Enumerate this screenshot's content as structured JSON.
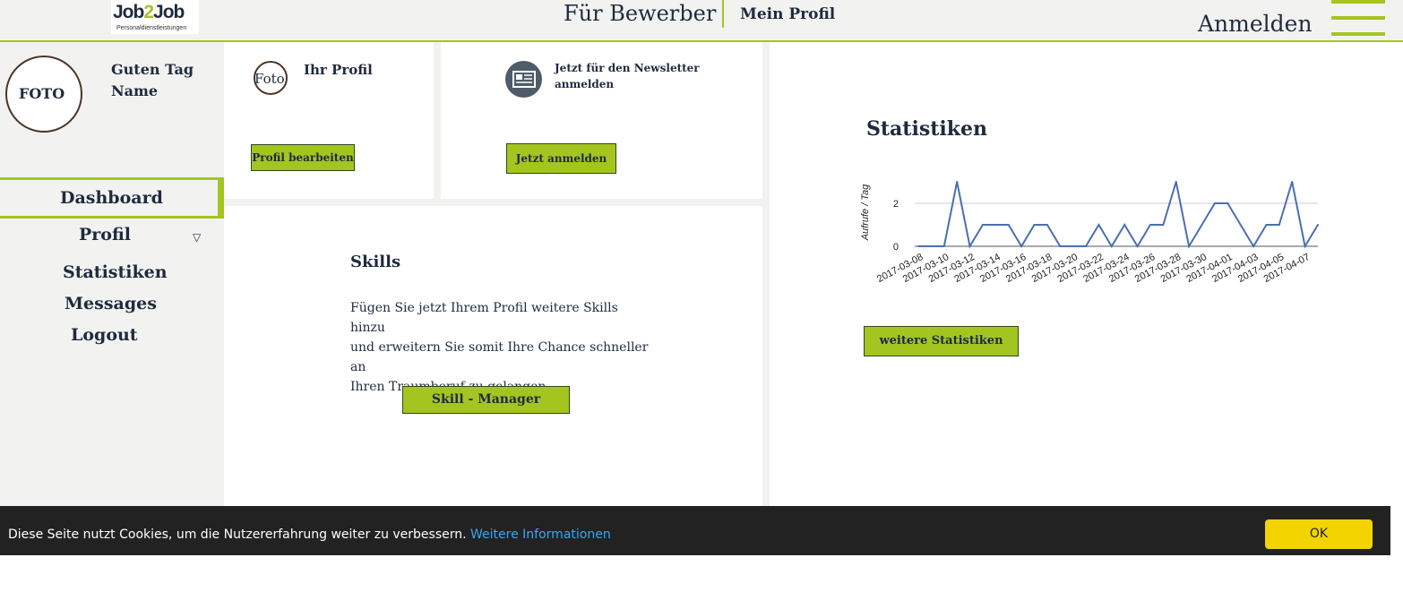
{
  "header": {
    "logo_main_a": "Job",
    "logo_main_b": "2",
    "logo_main_c": "Job",
    "logo_sub": "Personaldienstleistungen",
    "nav_apply": "Für Bewerber",
    "nav_profile": "Mein Profil",
    "login": "Anmelden",
    "menu_icon": "hamburger-icon"
  },
  "sidebar": {
    "avatar_label": "FOTO",
    "greeting_line1": "Guten Tag",
    "greeting_line2": "Name",
    "items": [
      {
        "label": "Dashboard",
        "active": true
      },
      {
        "label": "Profil",
        "has_dropdown": true
      },
      {
        "label": "Statistiken"
      },
      {
        "label": "Messages"
      },
      {
        "label": "Logout"
      }
    ]
  },
  "profile_card": {
    "icon_label": "Foto",
    "title": "Ihr Profil",
    "button": "Profil bearbeiten"
  },
  "newsletter_card": {
    "icon": "newspaper-icon",
    "title_line1": "Jetzt für den Newsletter",
    "title_line2": "anmelden",
    "button": "Jetzt anmelden"
  },
  "skills_card": {
    "title": "Skills",
    "text_line1": "Fügen Sie jetzt Ihrem Profil weitere Skills hinzu",
    "text_line2": "und erweitern Sie somit Ihre Chance schneller an",
    "text_line3": "Ihren Traumberuf zu gelangen.",
    "button": "Skill - Manager"
  },
  "stats_card": {
    "title": "Statistiken",
    "button": "weitere Statistiken"
  },
  "chart_data": {
    "type": "line",
    "ylabel": "Aufrufe / Tag",
    "ylim": [
      0,
      3
    ],
    "yticks": [
      0,
      2
    ],
    "grid": true,
    "series_color": "#4a6fb0",
    "x_tick_labels": [
      "2017-03-08",
      "2017-03-10",
      "2017-03-12",
      "2017-03-14",
      "2017-03-16",
      "2017-03-18",
      "2017-03-20",
      "2017-03-22",
      "2017-03-24",
      "2017-03-26",
      "2017-03-28",
      "2017-03-30",
      "2017-04-01",
      "2017-04-03",
      "2017-04-05",
      "2017-04-07"
    ],
    "x": [
      "2017-03-08",
      "2017-03-09",
      "2017-03-10",
      "2017-03-11",
      "2017-03-12",
      "2017-03-13",
      "2017-03-14",
      "2017-03-15",
      "2017-03-16",
      "2017-03-17",
      "2017-03-18",
      "2017-03-19",
      "2017-03-20",
      "2017-03-21",
      "2017-03-22",
      "2017-03-23",
      "2017-03-24",
      "2017-03-25",
      "2017-03-26",
      "2017-03-27",
      "2017-03-28",
      "2017-03-29",
      "2017-03-30",
      "2017-03-31",
      "2017-04-01",
      "2017-04-02",
      "2017-04-03",
      "2017-04-04",
      "2017-04-05",
      "2017-04-06",
      "2017-04-07",
      "2017-04-08"
    ],
    "values": [
      0,
      0,
      0,
      3,
      0,
      1,
      1,
      1,
      0,
      1,
      1,
      0,
      0,
      0,
      1,
      0,
      1,
      0,
      1,
      1,
      3,
      0,
      1,
      2,
      2,
      1,
      0,
      1,
      1,
      3,
      0,
      1
    ]
  },
  "cookie": {
    "text": "Diese Seite nutzt Cookies, um die Nutzererfahrung weiter zu verbessern.",
    "link": "Weitere Informationen",
    "button": "OK"
  }
}
